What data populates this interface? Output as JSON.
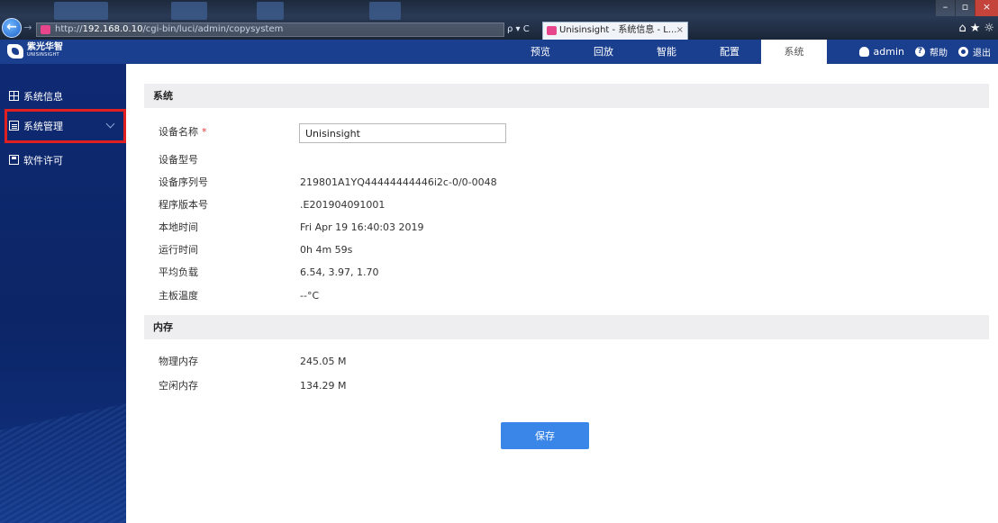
{
  "browser": {
    "address_prefix": "http://",
    "address_host": "192.168.0.10",
    "address_path": "/cgi-bin/luci/admin/copysystem",
    "search_controls": "ρ ▾ C",
    "tab_title": "Unisinsight - 系统信息 - L...",
    "tab_close": "×",
    "win_min": "–",
    "win_max": "▫",
    "win_close": "×",
    "fav_icons": "⌂★☼"
  },
  "header": {
    "logo_cn": "紫光华智",
    "logo_en": "UNISINSIGHT",
    "nav": [
      {
        "label": "预览"
      },
      {
        "label": "回放"
      },
      {
        "label": "智能"
      },
      {
        "label": "配置"
      },
      {
        "label": "系统",
        "active": true
      }
    ],
    "user": "admin",
    "help": "帮助",
    "logout": "退出"
  },
  "sidebar": {
    "items": [
      {
        "label": "系统信息"
      },
      {
        "label": "系统管理"
      },
      {
        "label": "软件许可"
      }
    ]
  },
  "system_section": {
    "title": "系统",
    "device_name_label": "设备名称",
    "required_mark": "*",
    "device_name_value": "Unisinsight",
    "rows": [
      {
        "label": "设备型号",
        "value": ""
      },
      {
        "label": "设备序列号",
        "value": "219801A1YQ44444444446i2c-0/0-0048"
      },
      {
        "label": "程序版本号",
        "value": ".E201904091001"
      },
      {
        "label": "本地时间",
        "value": "Fri Apr 19 16:40:03 2019"
      },
      {
        "label": "运行时间",
        "value": "0h 4m 59s"
      },
      {
        "label": "平均负载",
        "value": "6.54, 3.97, 1.70"
      },
      {
        "label": "主板温度",
        "value": "--°C"
      }
    ]
  },
  "memory_section": {
    "title": "内存",
    "rows": [
      {
        "label": "物理内存",
        "value": "245.05 M"
      },
      {
        "label": "空闲内存",
        "value": "134.29 M"
      }
    ]
  },
  "actions": {
    "save_label": "保存"
  }
}
